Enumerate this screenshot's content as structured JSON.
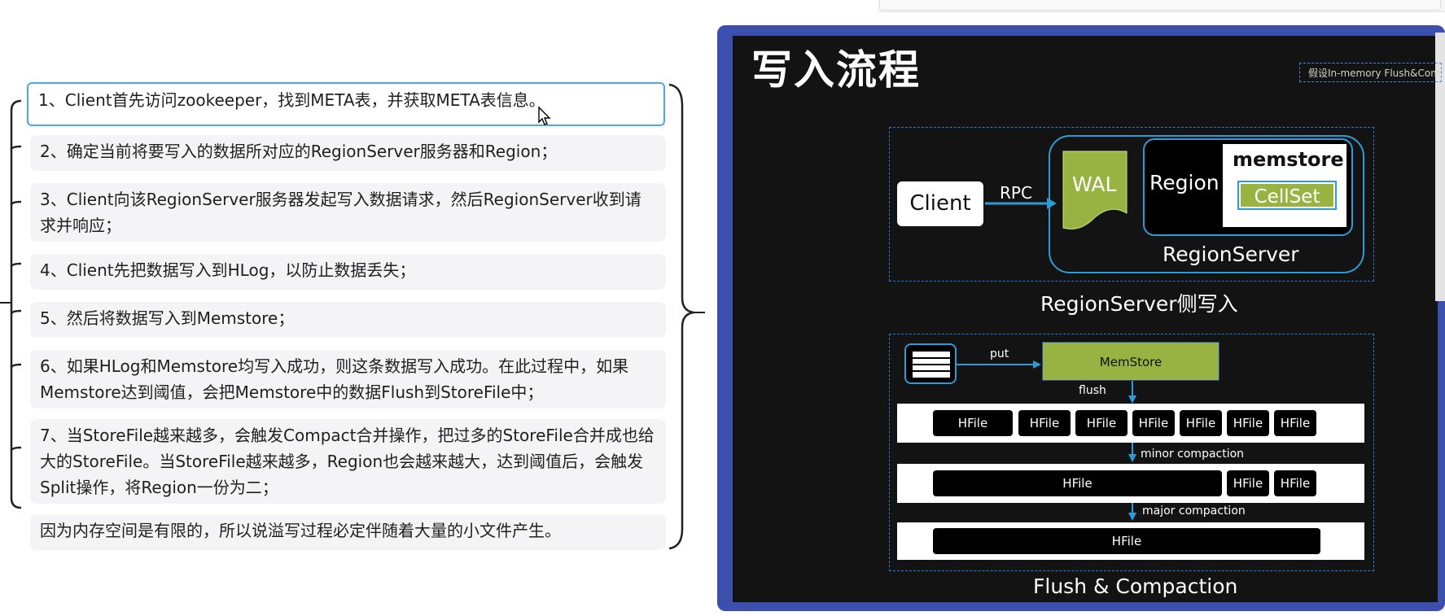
{
  "outline": {
    "items": [
      "1、Client首先访问zookeeper，找到META表，并获取META表信息。",
      "2、确定当前将要写入的数据所对应的RegionServer服务器和Region；",
      "3、Client向该RegionServer服务器发起写入数据请求，然后RegionServer收到请求并响应；",
      "4、Client先把数据写入到HLog，以防止数据丢失；",
      "5、然后将数据写入到Memstore；",
      "6、如果HLog和Memstore均写入成功，则这条数据写入成功。在此过程中，如果Memstore达到阈值，会把Memstore中的数据Flush到StoreFile中；",
      "7、当StoreFile越来越多，会触发Compact合并操作，把过多的StoreFile合并成也给大的StoreFile。当StoreFile越来越多，Region也会越来越大，达到阈值后，会触发Split操作，将Region一份为二；",
      "因为内存空间是有限的，所以说溢写过程必定伴随着大量的小文件产生。"
    ],
    "selected_index": 0
  },
  "slide": {
    "title": "写入流程",
    "note": "假设In-memory Flush&Compaction",
    "diagram1": {
      "client": "Client",
      "rpc": "RPC",
      "wal": "WAL",
      "region": "Region",
      "memstore": "memstore",
      "cellset": "CellSet",
      "regionserver": "RegionServer",
      "caption": "RegionServer侧写入"
    },
    "diagram2": {
      "put": "put",
      "memstore": "MemStore",
      "flush": "flush",
      "hfile": "HFile",
      "minor": "minor compaction",
      "major": "major compaction",
      "caption": "Flush & Compaction"
    }
  },
  "colors": {
    "selected_border": "#47a8f5",
    "slide_frame": "#3c4fad",
    "accent_green": "#98b342",
    "accent_blue": "#2e9bd6"
  }
}
